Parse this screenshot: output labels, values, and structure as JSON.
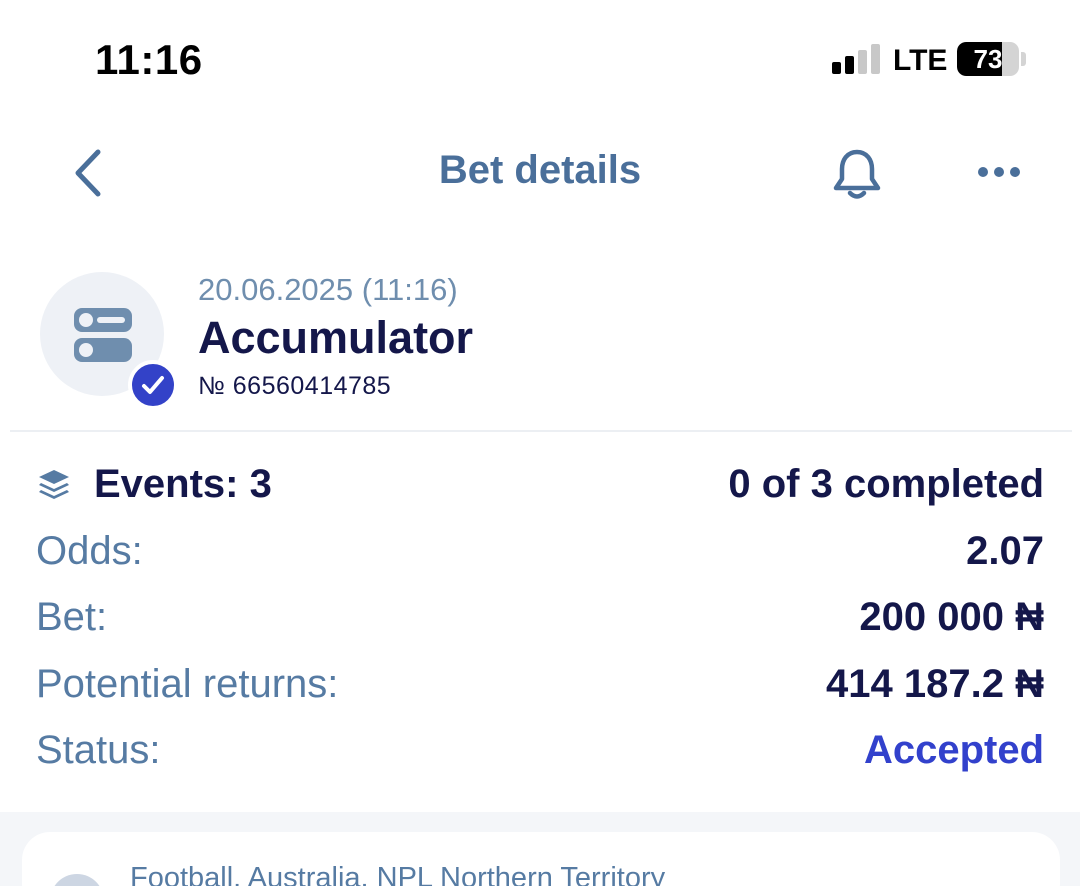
{
  "status_bar": {
    "time": "11:16",
    "network": "LTE",
    "battery_level": "73",
    "signal_bars_active": 2,
    "signal_bars_total": 4
  },
  "nav": {
    "title": "Bet details",
    "back_icon": "chevron-left-icon",
    "bell_icon": "bell-icon",
    "more_icon": "more-horizontal-icon"
  },
  "bet": {
    "date": "20.06.2025 (11:16)",
    "type": "Accumulator",
    "number": "№ 66560414785",
    "type_icon": "toggles-icon",
    "status_icon": "check-icon"
  },
  "summary": {
    "events_label": "Events: 3",
    "events_value": "0 of 3 completed",
    "odds_label": "Odds:",
    "odds_value": "2.07",
    "bet_label": "Bet:",
    "bet_value": "200 000 ₦",
    "returns_label": "Potential returns:",
    "returns_value": "414 187.2 ₦",
    "status_label": "Status:",
    "status_value": "Accepted"
  },
  "event": {
    "path": "Football. Australia. NPL Northern Territory"
  },
  "colors": {
    "accent": "#3241cc",
    "label": "#567ba3",
    "text": "#14174a",
    "nav": "#4a6f9a"
  }
}
